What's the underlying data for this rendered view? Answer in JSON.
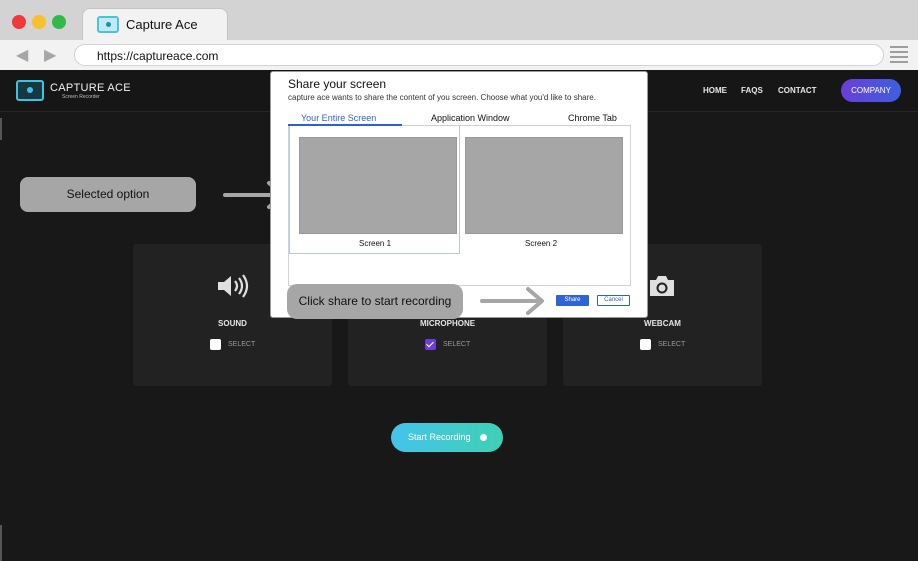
{
  "browser": {
    "tab_title": "Capture Ace",
    "url": "https://captureace.com"
  },
  "header": {
    "logo_title": "CAPTURE ACE",
    "logo_subtitle": "Screen Recorder",
    "nav": [
      "HOME",
      "FAQS",
      "CONTACT"
    ],
    "company_button": "COMPANY"
  },
  "cards": [
    {
      "label": "SOUND",
      "select": "SELECT",
      "checked": false,
      "icon": "speaker-icon"
    },
    {
      "label": "MICROPHONE",
      "select": "SELECT",
      "checked": true,
      "icon": "microphone-icon"
    },
    {
      "label": "WEBCAM",
      "select": "SELECT",
      "checked": false,
      "icon": "camera-icon"
    }
  ],
  "record_button": "Start Recording",
  "annotations": {
    "selected_option": "Selected option",
    "click_share": "Click share to start recording"
  },
  "dialog": {
    "title": "Share your screen",
    "subtitle": "capture ace wants to share the content of you screen. Choose what you'd like to share.",
    "tabs": [
      "Your Entire Screen",
      "Application Window",
      "Chrome Tab"
    ],
    "active_tab": "Your Entire Screen",
    "screens": [
      "Screen 1",
      "Screen 2"
    ],
    "selected_screen": "Screen 1",
    "share_label": "Share",
    "cancel_label": "Cancel"
  },
  "colors": {
    "accent_blue": "#2f5fd4",
    "record_gradient_start": "#44c4ea",
    "record_gradient_end": "#3fd0b4",
    "company_gradient_start": "#6a3ed8",
    "company_gradient_end": "#3d5fe0",
    "page_background": "#181818",
    "annotation_gray": "#a6a6a6"
  }
}
